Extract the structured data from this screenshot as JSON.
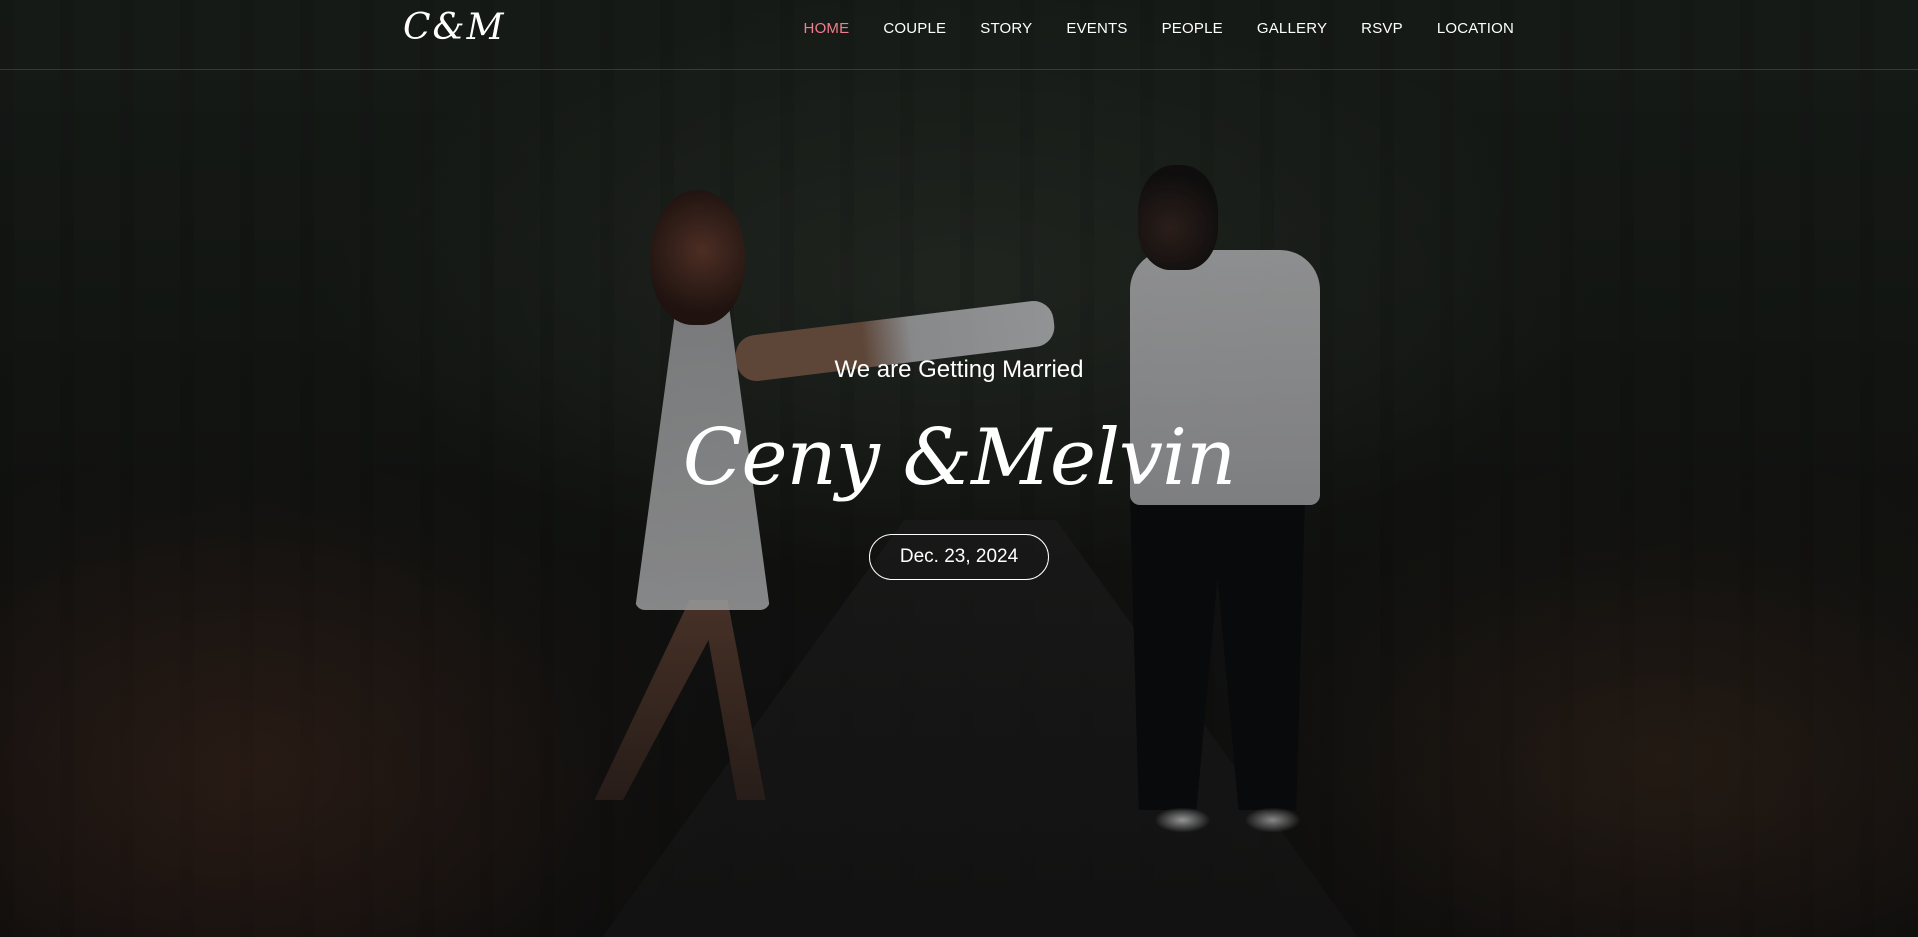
{
  "header": {
    "logo": "C&M",
    "nav": [
      {
        "label": "HOME",
        "active": true
      },
      {
        "label": "COUPLE",
        "active": false
      },
      {
        "label": "STORY",
        "active": false
      },
      {
        "label": "EVENTS",
        "active": false
      },
      {
        "label": "PEOPLE",
        "active": false
      },
      {
        "label": "GALLERY",
        "active": false
      },
      {
        "label": "RSVP",
        "active": false
      },
      {
        "label": "LOCATION",
        "active": false
      }
    ]
  },
  "hero": {
    "subtitle": "We are Getting Married",
    "names": "Ceny &Melvin",
    "date": "Dec. 23, 2024"
  },
  "colors": {
    "accent": "#ef7f8c",
    "text": "#ffffff"
  }
}
